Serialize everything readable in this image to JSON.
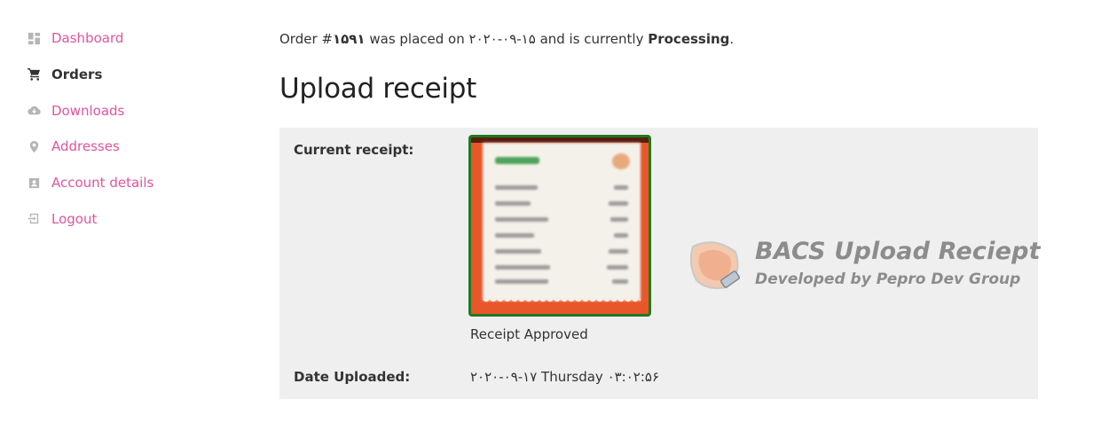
{
  "sidebar": {
    "items": [
      {
        "label": "Dashboard",
        "icon": "dashboard-icon",
        "active": false
      },
      {
        "label": "Orders",
        "icon": "cart-icon",
        "active": true
      },
      {
        "label": "Downloads",
        "icon": "cloud-download-icon",
        "active": false
      },
      {
        "label": "Addresses",
        "icon": "location-pin-icon",
        "active": false
      },
      {
        "label": "Account details",
        "icon": "user-card-icon",
        "active": false
      },
      {
        "label": "Logout",
        "icon": "logout-icon",
        "active": false
      }
    ]
  },
  "order": {
    "prefix": "Order #",
    "number": "۱۵۹۱",
    "mid": " was placed on ",
    "date": "۲۰۲۰-۰۹-۱۵",
    "mid2": " and is currently ",
    "status": "Processing",
    "suffix": "."
  },
  "upload": {
    "title": "Upload receipt",
    "current_label": "Current receipt:",
    "receipt_status": "Receipt Approved",
    "date_label": "Date Uploaded:",
    "date_value": "۲۰۲۰-۰۹-۱۷ Thursday ۰۳:۰۲:۵۶"
  },
  "watermark": {
    "title": "BACS Upload Reciept",
    "subtitle": "Developed by Pepro Dev Group"
  },
  "colors": {
    "link": "#e0559c",
    "panel_bg": "#efefef",
    "thumb_border": "#1f7a1f",
    "thumb_bg": "#e8562a"
  }
}
